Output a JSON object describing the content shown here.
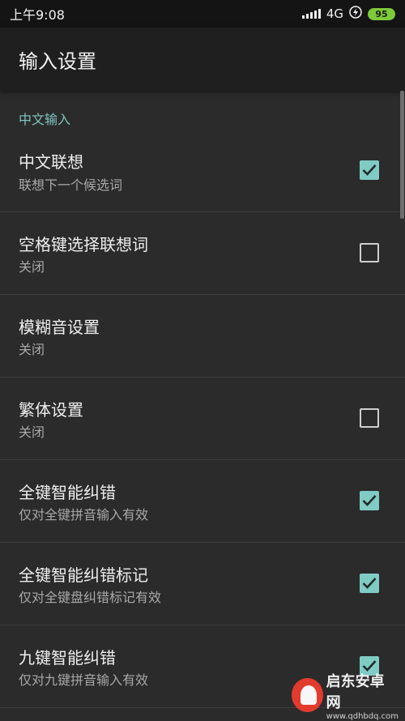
{
  "status": {
    "time": "上午9:08",
    "network": "4G",
    "battery": "95"
  },
  "header": {
    "title": "输入设置"
  },
  "section": {
    "label": "中文输入"
  },
  "items": [
    {
      "title": "中文联想",
      "subtitle": "联想下一个候选词",
      "checked": true
    },
    {
      "title": "空格键选择联想词",
      "subtitle": "关闭",
      "checked": false
    },
    {
      "title": "模糊音设置",
      "subtitle": "关闭",
      "checked": null
    },
    {
      "title": "繁体设置",
      "subtitle": "关闭",
      "checked": false
    },
    {
      "title": "全键智能纠错",
      "subtitle": "仅对全键拼音输入有效",
      "checked": true
    },
    {
      "title": "全键智能纠错标记",
      "subtitle": "仅对全键盘纠错标记有效",
      "checked": true
    },
    {
      "title": "九键智能纠错",
      "subtitle": "仅对九键拼音输入有效",
      "checked": true
    }
  ],
  "watermark": {
    "name": "启东安卓网",
    "url": "www.qdhbdq.com"
  },
  "colors": {
    "accent": "#80cbc4",
    "section": "#7fc4bd",
    "background": "#2b2b2b"
  }
}
